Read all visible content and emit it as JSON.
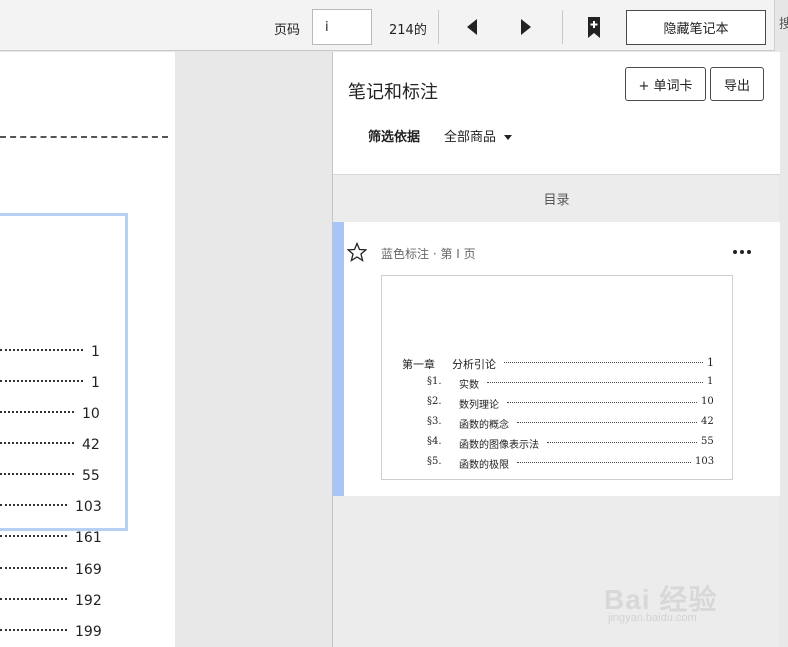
{
  "toolbar": {
    "page_label": "页码",
    "page_value": "i",
    "total_pages": "214的",
    "prev_icon": "triangle-left-icon",
    "next_icon": "triangle-right-icon",
    "bookmark_icon": "bookmark-add-icon",
    "hide_notes_label": "隐藏笔记本",
    "edge_text": "搜"
  },
  "document": {
    "toc_page_numbers": [
      "1",
      "1",
      "10",
      "42",
      "55",
      "103",
      "161",
      "169",
      "192",
      "199"
    ]
  },
  "panel": {
    "title": "笔记和标注",
    "flashcard_label": "+ 单词卡",
    "export_label": "导出",
    "filter_label": "筛选依据",
    "filter_value": "全部商品",
    "section_label": "目录",
    "note": {
      "star_icon": "star-outline-icon",
      "meta": "蓝色标注 · 第 I 页",
      "more_icon": "more-horizontal-icon",
      "snippet": [
        {
          "lead": "第一章",
          "title": "分析引论",
          "page": "1"
        },
        {
          "lead": "§1.",
          "title": "实数",
          "page": "1"
        },
        {
          "lead": "§2.",
          "title": "数列理论",
          "page": "10"
        },
        {
          "lead": "§3.",
          "title": "函数的概念",
          "page": "42"
        },
        {
          "lead": "§4.",
          "title": "函数的图像表示法",
          "page": "55"
        },
        {
          "lead": "§5.",
          "title": "函数的极限",
          "page": "103"
        }
      ]
    }
  },
  "colors": {
    "highlight_blue": "#a9c4f8",
    "toolbar_bg": "#f3f3f3",
    "panel_bg": "#ececec"
  },
  "watermark": {
    "brand": "Bai 经验",
    "sub": "jingyan.baidu.com"
  }
}
